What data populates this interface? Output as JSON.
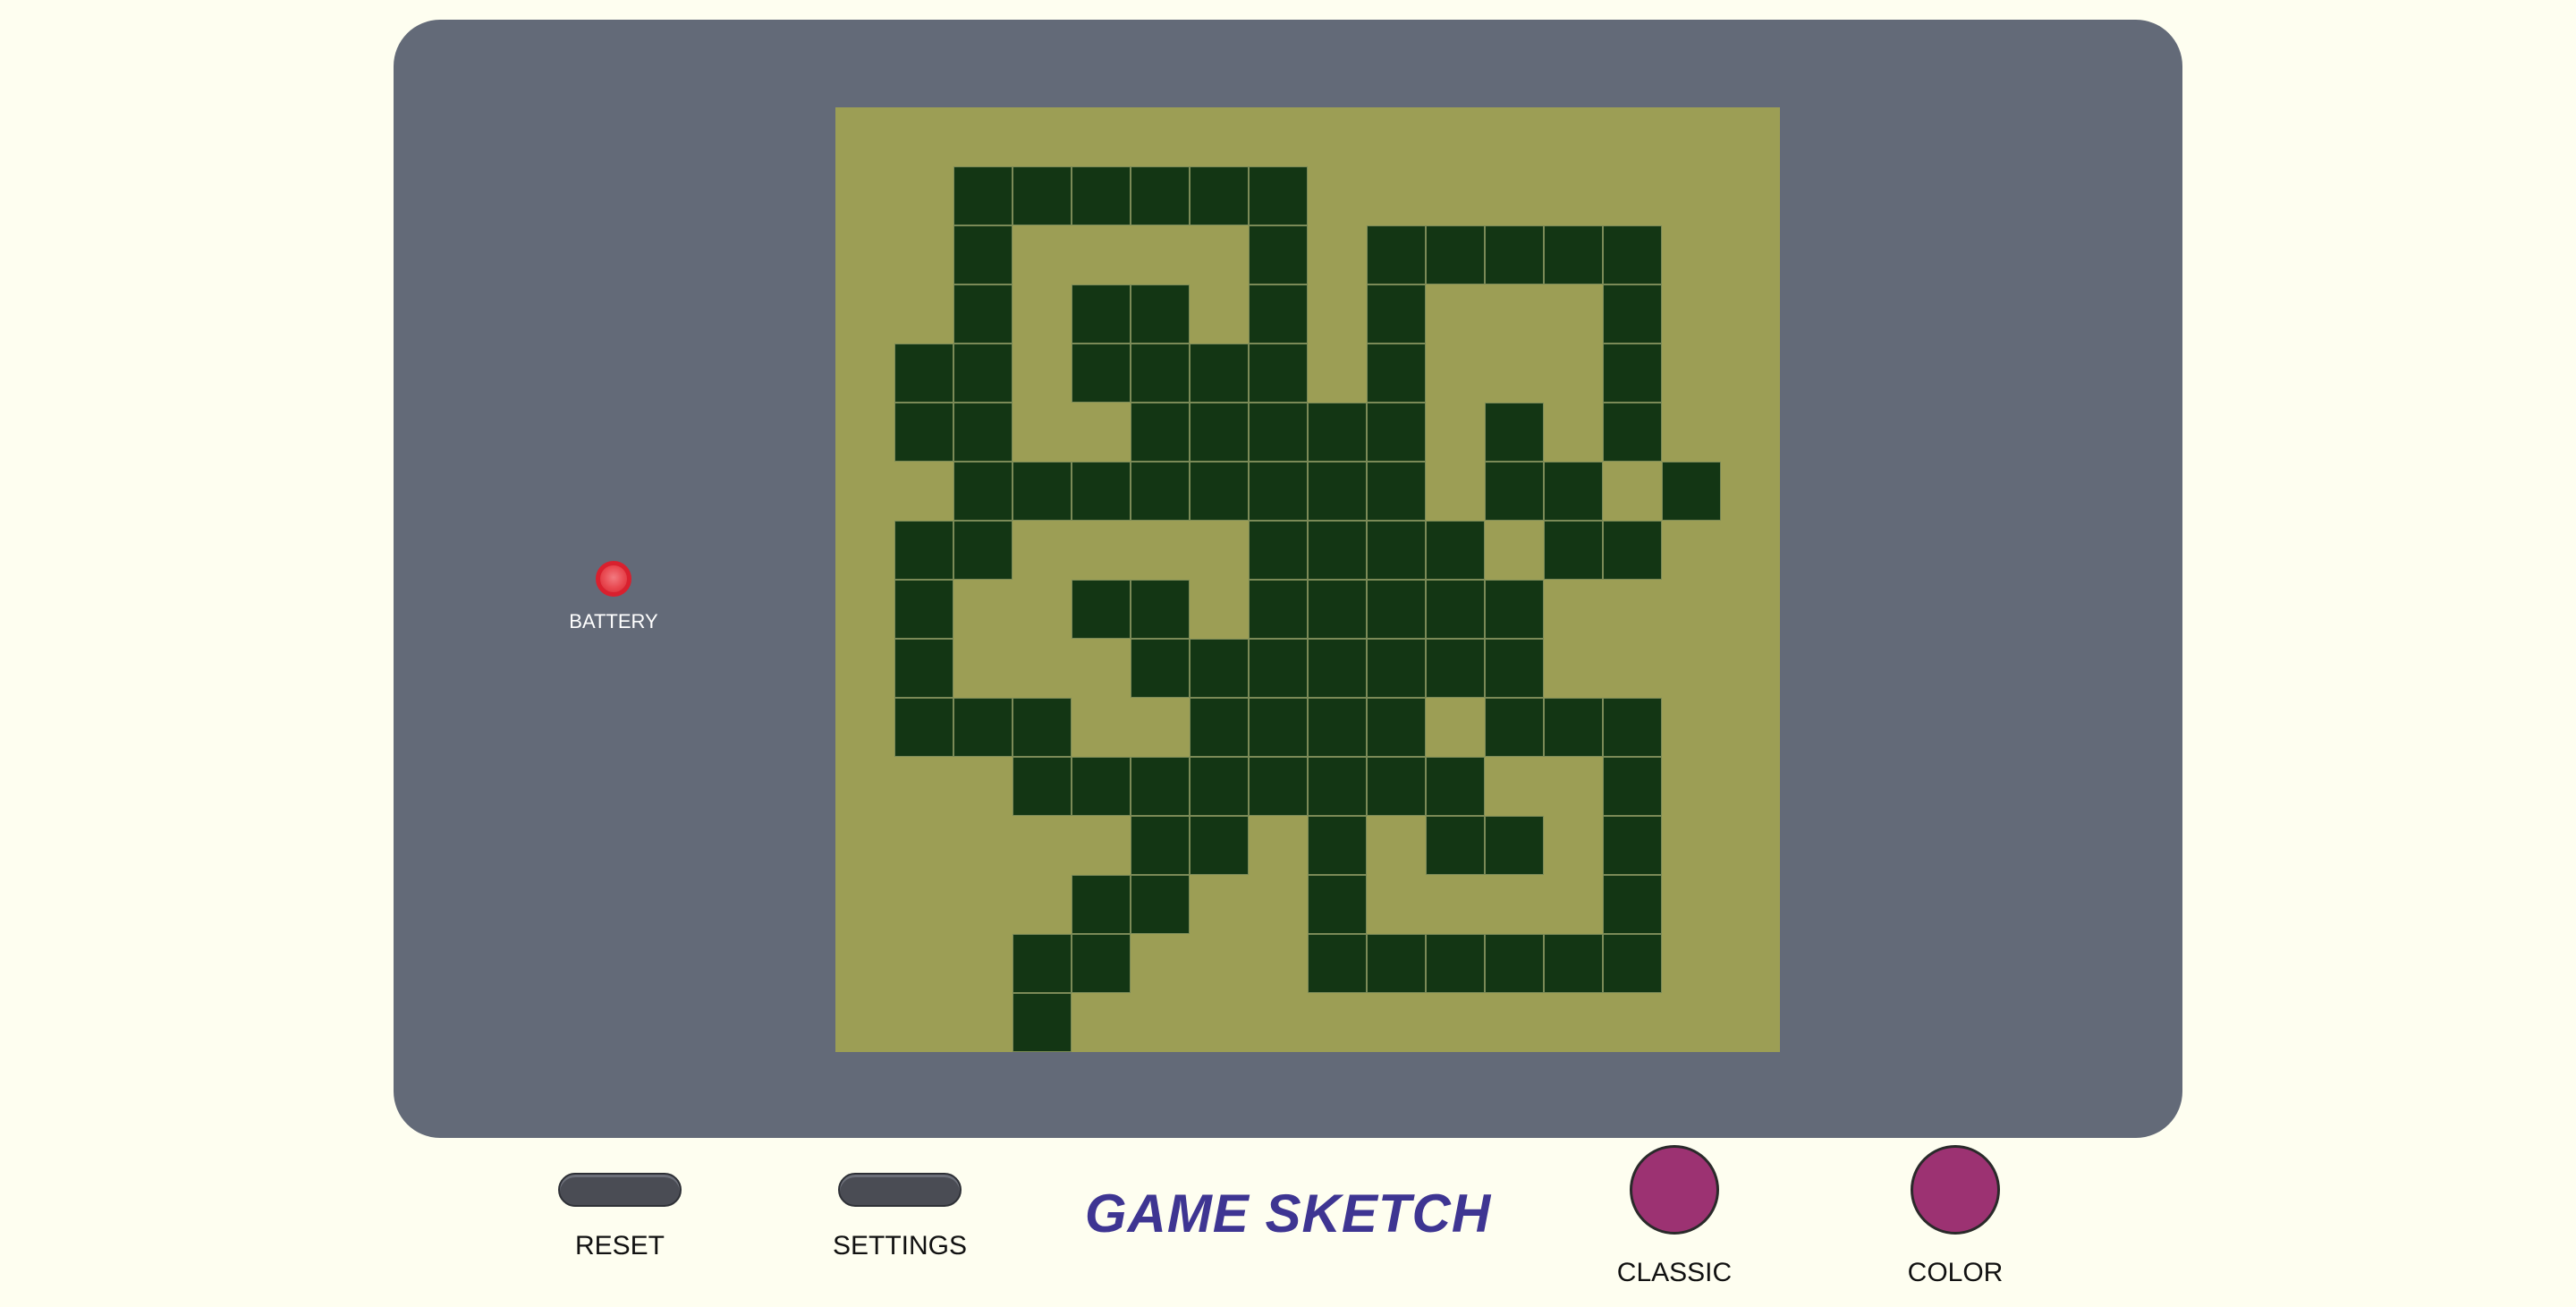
{
  "device": {
    "brand": "GAME SKETCH",
    "battery_label": "BATTERY",
    "colors": {
      "background": "#fefef0",
      "body": "#636a78",
      "screen": "#9c9e55",
      "pixel_on": "#133614",
      "pixel_grid": "#7b8a57",
      "brand_text": "#3e3592",
      "round_button": "#9c3272",
      "battery_led": "#e8474f"
    }
  },
  "buttons": {
    "reset": "RESET",
    "settings": "SETTINGS",
    "classic": "CLASSIC",
    "color": "COLOR"
  },
  "screen": {
    "grid_size": 16,
    "pixels": [
      "0000000000000000",
      "0011111100000000",
      "0010000101111100",
      "0010110101000100",
      "0110111101000100",
      "0110011111010100",
      "0011111111011010",
      "0110000111101100",
      "0100110111110000",
      "0100011111110000",
      "0111001111011100",
      "0001111111100100",
      "0000011010110100",
      "0000110010000100",
      "0001100011111100",
      "0001000000000000"
    ]
  }
}
